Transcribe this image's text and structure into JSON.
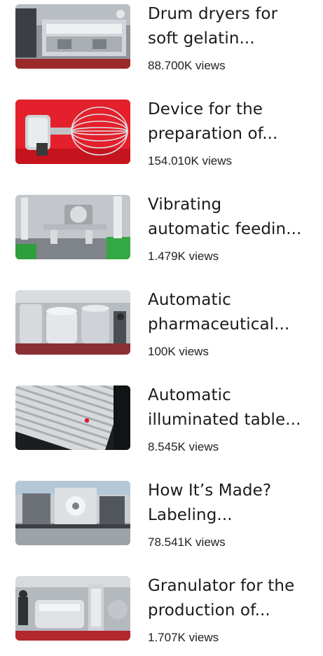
{
  "videos": [
    {
      "title_line1": "Drum dryers for",
      "title_line2": "soft gelatin...",
      "views": "88.700K views",
      "thumb_icon": "drum-dryer-machine"
    },
    {
      "title_line1": "Device for the",
      "title_line2": "preparation of...",
      "views": "154.010K views",
      "thumb_icon": "whisk-mixer"
    },
    {
      "title_line1": "Vibrating",
      "title_line2": "automatic feedin...",
      "views": "1.479K views",
      "thumb_icon": "vibrating-feeder"
    },
    {
      "title_line1": "Automatic",
      "title_line2": "pharmaceutical...",
      "views": "100K views",
      "thumb_icon": "pharmaceutical-tanks"
    },
    {
      "title_line1": "Automatic",
      "title_line2": "illuminated table...",
      "views": "8.545K views",
      "thumb_icon": "illuminated-table"
    },
    {
      "title_line1": "How It’s Made?",
      "title_line2": "Labeling...",
      "views": "78.541K views",
      "thumb_icon": "labeling-machine"
    },
    {
      "title_line1": "Granulator for the",
      "title_line2": "production of...",
      "views": "1.707K views",
      "thumb_icon": "granulator"
    }
  ]
}
